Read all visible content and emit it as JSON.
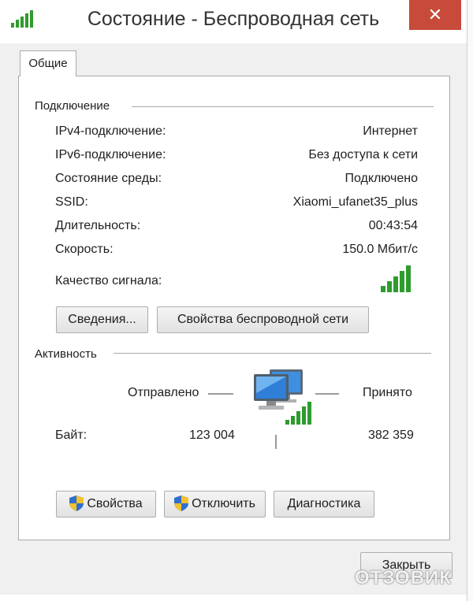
{
  "window": {
    "title": "Состояние - Беспроводная сеть",
    "close_glyph": "✕"
  },
  "tabs": [
    {
      "label": "Общие",
      "active": true
    }
  ],
  "connection": {
    "group_title": "Подключение",
    "rows": [
      {
        "label": "IPv4-подключение:",
        "value": "Интернет"
      },
      {
        "label": "IPv6-подключение:",
        "value": "Без доступа к сети"
      },
      {
        "label": "Состояние среды:",
        "value": "Подключено"
      },
      {
        "label": "SSID:",
        "value": "Xiaomi_ufanet35_plus"
      },
      {
        "label": "Длительность:",
        "value": "00:43:54"
      },
      {
        "label": "Скорость:",
        "value": "150.0 Мбит/с"
      }
    ],
    "signal_label": "Качество сигнала:",
    "signal_bars": 5,
    "details_button": "Сведения...",
    "wireless_props_button": "Свойства беспроводной сети"
  },
  "activity": {
    "group_title": "Активность",
    "sent_label": "Отправлено",
    "received_label": "Принято",
    "bytes_label": "Байт:",
    "bytes_sent": "123 004",
    "bytes_received": "382 359"
  },
  "action_buttons": {
    "properties": "Свойства",
    "disable": "Отключить",
    "diagnostics": "Диагностика"
  },
  "footer": {
    "close_button": "Закрыть"
  },
  "watermark": "ОТЗОВИК",
  "colors": {
    "signal_green": "#2e9b2e",
    "close_red": "#c74a3a",
    "accent_blue": "#2f7fd8"
  },
  "icons": [
    "wifi-signal-icon",
    "close-icon",
    "network-computers-icon",
    "uac-shield-icon"
  ]
}
